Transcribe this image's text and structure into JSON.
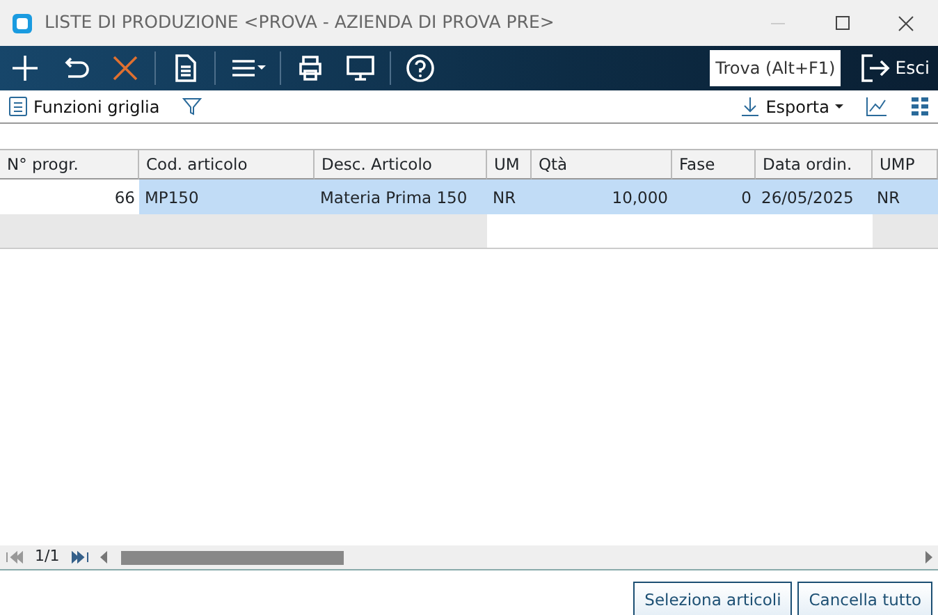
{
  "window": {
    "title": "LISTE DI PRODUZIONE <PROVA - AZIENDA DI PROVA PRE>"
  },
  "toolbar": {
    "search_button": "Trova (Alt+F1)",
    "exit_button": "Esci"
  },
  "grid_toolbar": {
    "functions": "Funzioni griglia",
    "export": "Esporta"
  },
  "table": {
    "columns": [
      "N° progr.",
      "Cod. articolo",
      "Desc. Articolo",
      "UM",
      "Qtà",
      "Fase",
      "Data ordin.",
      "UMP"
    ],
    "rows": [
      {
        "selected": true,
        "cells": [
          "66",
          "MP150",
          "Materia Prima 150",
          "NR",
          "10,000",
          "0",
          "26/05/2025",
          "NR"
        ]
      }
    ]
  },
  "pager": {
    "page": "1/1"
  },
  "buttons": [
    "Seleziona articoli",
    "Cancella tutto"
  ]
}
